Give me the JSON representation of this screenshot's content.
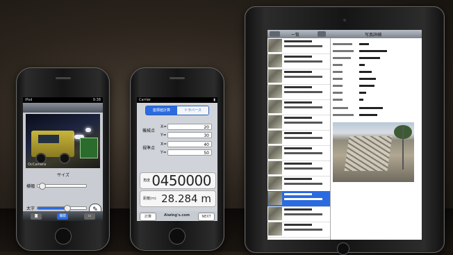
{
  "phone1": {
    "status_carrier": "iPod",
    "status_time": "9:38",
    "camera_caption": "OcCamera",
    "size_title": "サイズ",
    "slider1_label": "横幅",
    "slider2_label": "太字",
    "slider1_value": 0.05,
    "slider2_value": 0.55,
    "tab_active_label": "撮影"
  },
  "phone2": {
    "status_carrier": "Carrier",
    "tab_active": "座標値計算",
    "tab_inactive": "トラバース",
    "group1_label": "機械点",
    "group2_label": "視準点",
    "rows": [
      {
        "key": "X=",
        "value": "20"
      },
      {
        "key": "Y=",
        "value": "30"
      },
      {
        "key": "X=",
        "value": "40"
      },
      {
        "key": "Y=",
        "value": "50"
      }
    ],
    "angle_label": "角度",
    "angle_value": "0450000",
    "distance_label": "距離(m)",
    "distance_value": "28.284",
    "distance_unit": "m",
    "left_button": "計算",
    "brand": "Aiwing's.com",
    "next_button": "NEXT"
  },
  "ipad": {
    "nav_left": "一覧",
    "nav_right": "写真詳細"
  }
}
